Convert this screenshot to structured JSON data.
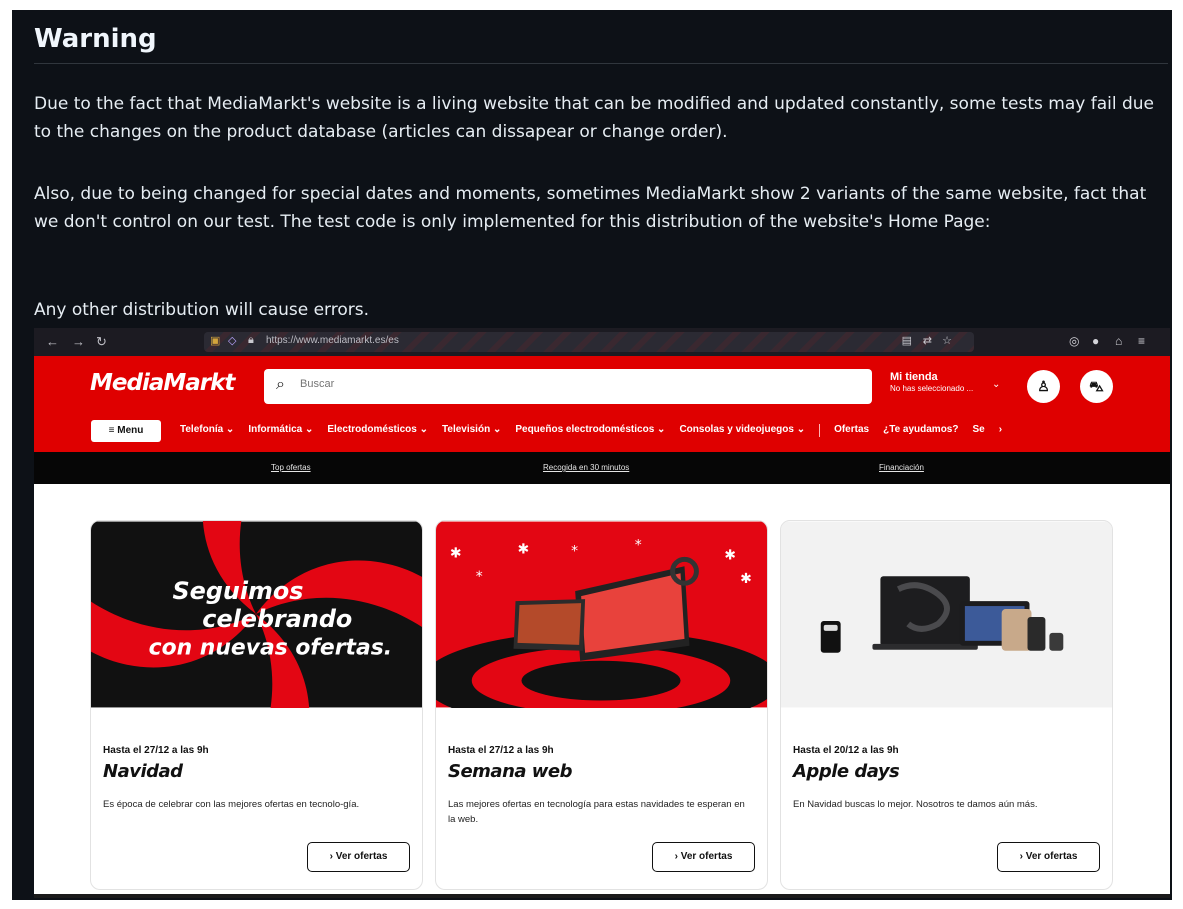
{
  "readme": {
    "heading": "Warning",
    "p1": "Due to the fact that MediaMarkt's website is a living website that can be modified and updated constantly, some tests may fail due to the changes on the product database (articles can dissapear or change order).",
    "p2": "Also, due to being changed for special dates and moments, sometimes MediaMarkt show 2 variants of the same website, fact that we don't control on our test. The test code is only implemented for this distribution of the website's Home Page:",
    "p3": "Any other distribution will cause errors."
  },
  "browser": {
    "url": "https://www.mediamarkt.es/es",
    "icons": [
      "back-icon",
      "forward-icon",
      "reload-icon",
      "image-icon",
      "shield-icon",
      "lock-icon",
      "reader-icon",
      "translate-icon",
      "star-icon",
      "pocket-icon",
      "account-icon",
      "extensions-icon",
      "menu-icon"
    ]
  },
  "header": {
    "logo": "MediaMarkt",
    "search_placeholder": "Buscar",
    "store_title": "Mi tienda",
    "store_sub": "No has seleccionado ...",
    "menu_label": "Menu",
    "categories": [
      "Telefonía ⌄",
      "Informática ⌄",
      "Electrodomésticos ⌄",
      "Televisión ⌄",
      "Pequeños electrodomésticos ⌄",
      "Consolas y videojuegos ⌄"
    ],
    "extra_links": [
      "Ofertas",
      "¿Te ayudamos?",
      "Se"
    ],
    "brand_color": "#df0000"
  },
  "promo_bar": {
    "items": [
      "Top ofertas",
      "Recogida en 30 minutos",
      "Financiación"
    ]
  },
  "cards": [
    {
      "image_text": [
        "Seguimos",
        "celebrando",
        "con nuevas ofertas."
      ],
      "date": "Hasta el 27/12 a las 9h",
      "title": "Navidad",
      "desc": "Es época de celebrar con las mejores ofertas en tecnolo-gía.",
      "button": "Ver ofertas"
    },
    {
      "date": "Hasta el 27/12 a las 9h",
      "title": "Semana web",
      "desc": "Las mejores ofertas en tecnología para estas navidades te esperan en la web.",
      "button": "Ver ofertas"
    },
    {
      "date": "Hasta el 20/12 a las 9h",
      "title": "Apple days",
      "desc": "En Navidad buscas lo mejor. Nosotros te damos aún más.",
      "button": "Ver ofertas"
    }
  ]
}
